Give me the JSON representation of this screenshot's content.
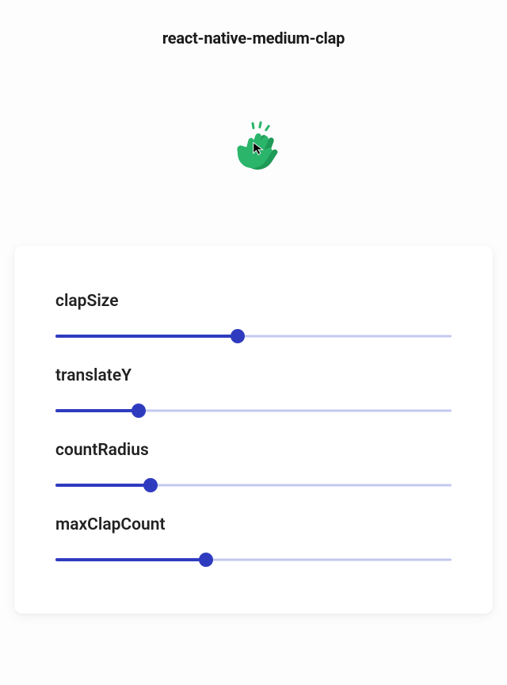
{
  "header": {
    "title": "react-native-medium-clap"
  },
  "clap": {
    "icon_color": "#2ab56b",
    "icon_name": "clap-hands-icon"
  },
  "panel": {
    "sliders": [
      {
        "label": "clapSize",
        "value": 46
      },
      {
        "label": "translateY",
        "value": 21
      },
      {
        "label": "countRadius",
        "value": 24
      },
      {
        "label": "maxClapCount",
        "value": 38
      }
    ],
    "accent": "#2f3bbf",
    "track": "#c3c8f0"
  }
}
